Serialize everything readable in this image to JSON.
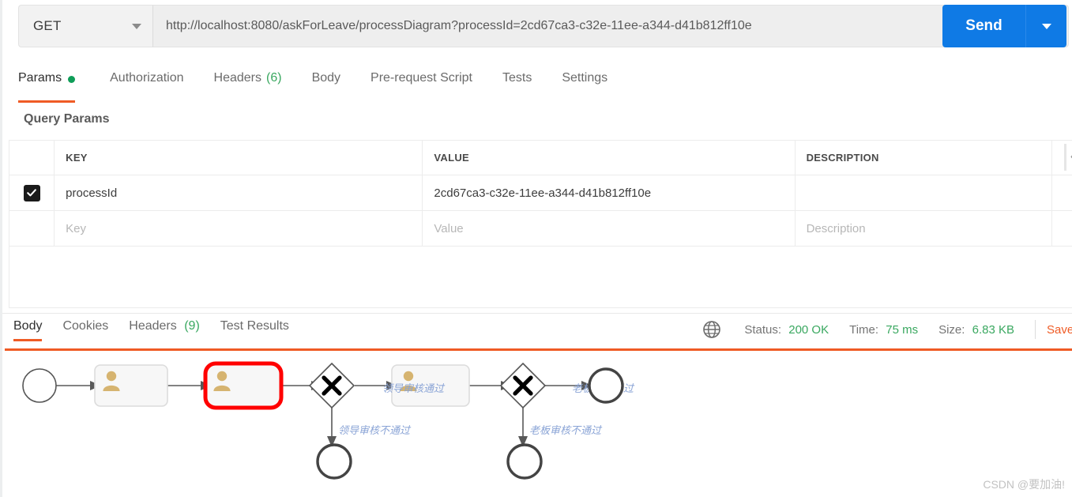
{
  "request": {
    "method": "GET",
    "method_caret_icon": "chevron-down-icon",
    "url": "http://localhost:8080/askForLeave/processDiagram?processId=2cd67ca3-c32e-11ee-a344-d41b812ff10e",
    "send_label": "Send",
    "send_caret_icon": "chevron-down-icon"
  },
  "request_tabs": [
    {
      "label": "Params",
      "count": "",
      "active": true,
      "dot": true
    },
    {
      "label": "Authorization",
      "count": "",
      "active": false,
      "dot": false
    },
    {
      "label": "Headers",
      "count": "(6)",
      "active": false,
      "dot": false
    },
    {
      "label": "Body",
      "count": "",
      "active": false,
      "dot": false
    },
    {
      "label": "Pre-request Script",
      "count": "",
      "active": false,
      "dot": false
    },
    {
      "label": "Tests",
      "count": "",
      "active": false,
      "dot": false
    },
    {
      "label": "Settings",
      "count": "",
      "active": false,
      "dot": false
    }
  ],
  "query_params": {
    "title": "Query Params",
    "columns": [
      "KEY",
      "VALUE",
      "DESCRIPTION"
    ],
    "rows": [
      {
        "checked": true,
        "key": "processId",
        "value": "2cd67ca3-c32e-11ee-a344-d41b812ff10e",
        "description": ""
      }
    ],
    "placeholder_row": {
      "key": "Key",
      "value": "Value",
      "description": "Description"
    },
    "edge_glyph": "«"
  },
  "response_tabs": [
    {
      "label": "Body",
      "count": "",
      "active": true
    },
    {
      "label": "Cookies",
      "count": "",
      "active": false
    },
    {
      "label": "Headers",
      "count": "(9)",
      "active": false
    },
    {
      "label": "Test Results",
      "count": "",
      "active": false
    }
  ],
  "response_meta": {
    "globe_icon": "globe-icon",
    "status_label": "Status:",
    "status_value": "200 OK",
    "time_label": "Time:",
    "time_value": "75 ms",
    "size_label": "Size:",
    "size_value": "6.83 KB",
    "save_label": "Save Response",
    "accent_green": "#3aa860",
    "accent_orange": "#ef5b25"
  },
  "diagram": {
    "type": "bpmn-process-diagram",
    "highlight_color": "#ff0000",
    "label_color": "#8aa4d6",
    "task_fill": "#f7f7f7",
    "person_icon_color": "#d6b470",
    "nodes": [
      {
        "id": "start",
        "type": "start-event",
        "label": ""
      },
      {
        "id": "task1",
        "type": "user-task",
        "label": "",
        "highlighted": false
      },
      {
        "id": "task2",
        "type": "user-task",
        "label": "",
        "highlighted": true
      },
      {
        "id": "gw1",
        "type": "exclusive-gateway",
        "label": ""
      },
      {
        "id": "task3",
        "type": "user-task",
        "label": "",
        "highlighted": false
      },
      {
        "id": "gw2",
        "type": "exclusive-gateway",
        "label": ""
      },
      {
        "id": "end1",
        "type": "end-event",
        "label": ""
      },
      {
        "id": "end2",
        "type": "end-event",
        "label": ""
      },
      {
        "id": "end3",
        "type": "end-event",
        "label": ""
      }
    ],
    "flow_labels": {
      "leader_pass": "领导审核通过",
      "leader_fail": "领导审核不通过",
      "boss_pass": "老板审核通过",
      "boss_fail": "老板审核不通过"
    }
  },
  "watermark": "CSDN @要加油!"
}
